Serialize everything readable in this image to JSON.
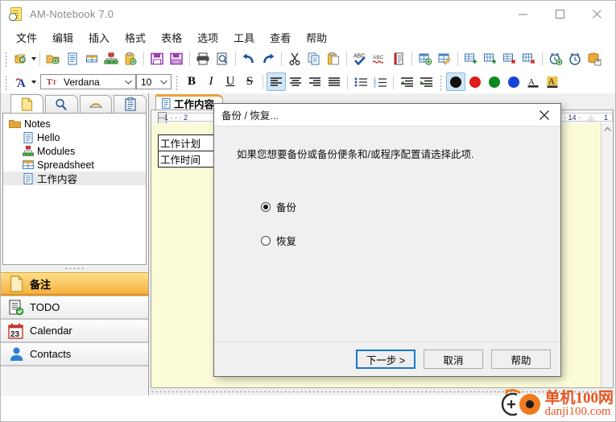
{
  "window": {
    "title": "AM-Notebook  7.0",
    "icon": "notebook-icon",
    "minimize": "—",
    "maximize": "▢",
    "close": "✕"
  },
  "menubar": {
    "items": [
      {
        "label": "文件",
        "name": "menu-file"
      },
      {
        "label": "编辑",
        "name": "menu-edit"
      },
      {
        "label": "插入",
        "name": "menu-insert"
      },
      {
        "label": "格式",
        "name": "menu-format"
      },
      {
        "label": "表格",
        "name": "menu-table"
      },
      {
        "label": "选项",
        "name": "menu-options"
      },
      {
        "label": "工具",
        "name": "menu-tools"
      },
      {
        "label": "查看",
        "name": "menu-view"
      },
      {
        "label": "帮助",
        "name": "menu-help"
      }
    ]
  },
  "toolbar_main": {
    "icons": [
      "new-note-dropdown",
      "new-folder",
      "new-text-note",
      "new-spreadsheet-note",
      "new-diagram-note",
      "new-clipboard-note",
      "save",
      "save-all",
      "print",
      "print-preview",
      "undo",
      "redo",
      "cut",
      "copy",
      "paste",
      "spell-check",
      "auto-correct",
      "word-count",
      "insert-table",
      "edit-table",
      "insert-row",
      "insert-column",
      "delete-row",
      "delete-column",
      "add-alarm",
      "alarm",
      "backup-database"
    ]
  },
  "toolbar_format": {
    "font_style_icon": "font-style-dropdown",
    "font_name": "Verdana",
    "font_size": "10",
    "bold": "B",
    "italic": "I",
    "underline": "U",
    "strike": "S",
    "align_left": "align-left",
    "align_center": "align-center",
    "align_right": "align-right",
    "align_justify": "align-justify",
    "bullet_list": "bullet-list",
    "number_list": "numbered-list",
    "outdent": "decrease-indent",
    "indent": "increase-indent",
    "colors": [
      {
        "name": "color-black",
        "hex": "#111111",
        "selected": true
      },
      {
        "name": "color-red",
        "hex": "#e01b1b",
        "selected": false
      },
      {
        "name": "color-green",
        "hex": "#0a8a1e",
        "selected": false
      },
      {
        "name": "color-blue",
        "hex": "#1743d6",
        "selected": false
      }
    ],
    "font_color_icon": "font-color",
    "highlight_icon": "text-highlight"
  },
  "sidebar": {
    "tabs": [
      {
        "name": "tab-notes",
        "icon": "page-icon",
        "active": true
      },
      {
        "name": "tab-search",
        "icon": "magnifier-icon",
        "active": false
      },
      {
        "name": "tab-highlighter",
        "icon": "eraser-icon",
        "active": false
      },
      {
        "name": "tab-clipboard",
        "icon": "clipboard-icon",
        "active": false
      }
    ],
    "tree": [
      {
        "label": "Notes",
        "icon": "folder-icon",
        "level": 0,
        "selected": false
      },
      {
        "label": "Hello",
        "icon": "text-note-icon",
        "level": 1,
        "selected": false
      },
      {
        "label": "Modules",
        "icon": "diagram-note-icon",
        "level": 1,
        "selected": false
      },
      {
        "label": "Spreadsheet",
        "icon": "spreadsheet-note-icon",
        "level": 1,
        "selected": false
      },
      {
        "label": "工作内容",
        "icon": "text-note-icon",
        "level": 1,
        "selected": true
      }
    ],
    "nav": [
      {
        "label": "备注",
        "icon": "note-page-icon",
        "active": true
      },
      {
        "label": "TODO",
        "icon": "todo-checklist-icon",
        "active": false
      },
      {
        "label": "Calendar",
        "icon": "calendar-23-icon",
        "active": false
      },
      {
        "label": "Contacts",
        "icon": "contact-person-icon",
        "active": false
      }
    ]
  },
  "editor": {
    "tab": {
      "label": "工作内容",
      "icon": "text-note-icon"
    },
    "ruler": {
      "ticks": "1   ·   ·   ·   2",
      "right_ticks": "· 14 ·",
      "far_ticks": "1"
    },
    "table": {
      "rows": [
        [
          "工作计划"
        ],
        [
          "工作时间"
        ]
      ]
    },
    "scroll_up": "▲"
  },
  "dialog": {
    "title": "备份 / 恢复...",
    "close": "✕",
    "description": "如果您想要备份或备份便条和/或程序配置请选择此项.",
    "options": [
      {
        "label": "备份",
        "selected": true,
        "name": "radio-backup"
      },
      {
        "label": "恢复",
        "selected": false,
        "name": "radio-restore"
      }
    ],
    "buttons": [
      {
        "label": "下一步 >",
        "name": "next-button",
        "default": true
      },
      {
        "label": "取消",
        "name": "cancel-button",
        "default": false
      },
      {
        "label": "帮助",
        "name": "help-button",
        "default": false
      }
    ]
  },
  "watermark": {
    "line1": "单机100网",
    "line2": "danji100.com"
  }
}
